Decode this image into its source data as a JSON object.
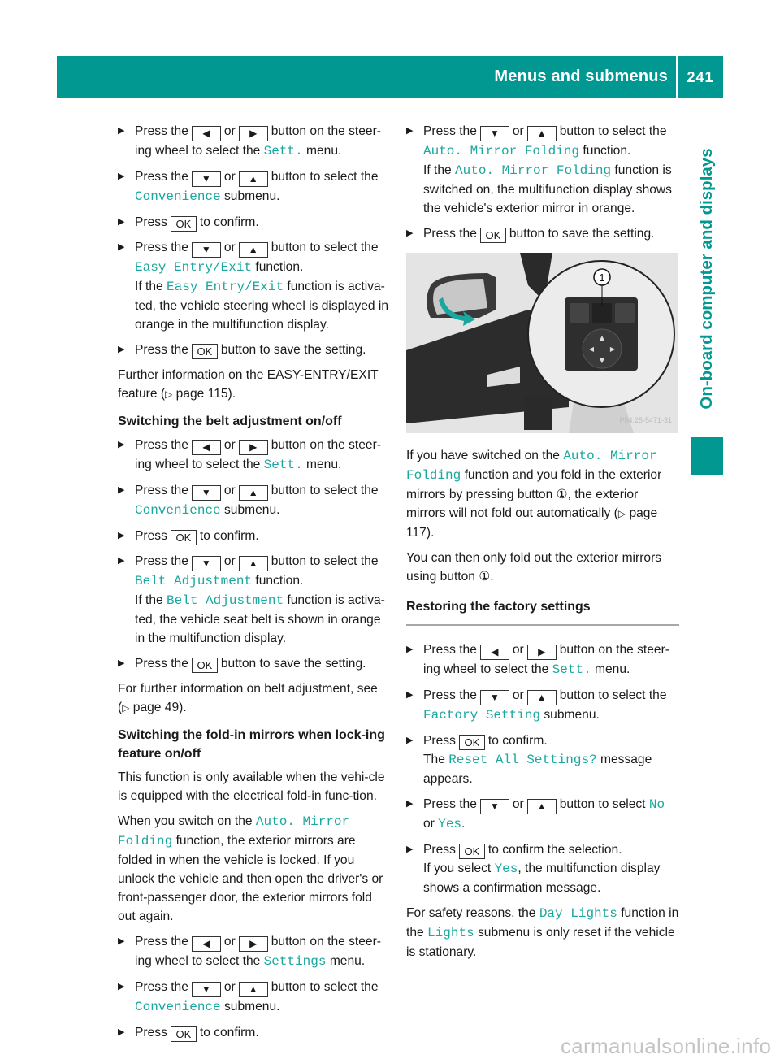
{
  "header": {
    "title": "Menus and submenus",
    "page_number": "241"
  },
  "side_tab": {
    "label": "On-board computer and displays"
  },
  "keys": {
    "left": "◀",
    "right": "▶",
    "down": "▼",
    "up": "▲",
    "ok": "OK"
  },
  "bullet": "▶",
  "ref_arrow": "▷",
  "left_column": {
    "s1": {
      "a": "Press the",
      "or": "or",
      "b": "button on the steer-ing wheel to select the",
      "term": "Sett.",
      "c": "menu."
    },
    "s2": {
      "a": "Press the",
      "or": "or",
      "b": "button to select the",
      "term": "Convenience",
      "c": "submenu."
    },
    "s3": {
      "a": "Press",
      "b": "to confirm."
    },
    "s4": {
      "a": "Press the",
      "or": "or",
      "b": "button to select the",
      "term": "Easy Entry/Exit",
      "c": "function.",
      "d": "If the",
      "term2": "Easy Entry/Exit",
      "e": "function is activa-ted, the vehicle steering wheel is displayed in orange in the multifunction display."
    },
    "s5": {
      "a": "Press the",
      "b": "button to save the setting."
    },
    "p1": {
      "a": "Further information on the EASY-ENTRY/EXIT feature (",
      "ref": "page 115",
      "b": ")."
    },
    "h1": "Switching the belt adjustment on/off",
    "s6": {
      "a": "Press the",
      "or": "or",
      "b": "button on the steer-ing wheel to select the",
      "term": "Sett.",
      "c": "menu."
    },
    "s7": {
      "a": "Press the",
      "or": "or",
      "b": "button to select the",
      "term": "Convenience",
      "c": "submenu."
    },
    "s8": {
      "a": "Press",
      "b": "to confirm."
    },
    "s9": {
      "a": "Press the",
      "or": "or",
      "b": "button to select the",
      "term": "Belt Adjustment",
      "c": "function.",
      "d": "If the",
      "term2": "Belt Adjustment",
      "e": "function is activa-ted, the vehicle seat belt is shown in orange in the multifunction display."
    },
    "s10": {
      "a": "Press the",
      "b": "button to save the setting."
    },
    "p2": {
      "a": "For further information on belt adjustment, see (",
      "ref": "page 49",
      "b": ")."
    },
    "h2": "Switching the fold-in mirrors when lock-ing feature on/off",
    "p3": "This function is only available when the vehi-cle is equipped with the electrical fold-in func-tion.",
    "p4": {
      "a": "When you switch on the",
      "term": "Auto. Mirror Folding",
      "b": "function, the exterior mirrors are folded in when the vehicle is locked. If you unlock the vehicle and then open the driver's or front-passenger door, the exterior mirrors fold out again."
    },
    "s11": {
      "a": "Press the",
      "or": "or",
      "b": "button on the steer-ing wheel to select the",
      "term": "Settings",
      "c": "menu."
    },
    "s12": {
      "a": "Press the",
      "or": "or",
      "b": "button to select the",
      "term": "Convenience",
      "c": "submenu."
    },
    "s13": {
      "a": "Press",
      "b": "to confirm."
    }
  },
  "right_column": {
    "s1": {
      "a": "Press the",
      "or": "or",
      "b": "button to select the",
      "term": "Auto. Mirror Folding",
      "c": "function.",
      "d": "If the",
      "term2": "Auto. Mirror Folding",
      "e": "function is switched on, the multifunction display shows the vehicle's exterior mirror in orange."
    },
    "s2": {
      "a": "Press the",
      "b": "button to save the setting."
    },
    "figure": {
      "callout": "1",
      "code": "P54.25-5471-31"
    },
    "p1": {
      "a": "If you have switched on the",
      "term": "Auto. Mirror Folding",
      "b": "function and you fold in the exterior mirrors by pressing button",
      "callout": "①",
      "c": ", the exterior mirrors will not fold out automatically (",
      "ref": "page 117",
      "d": ")."
    },
    "p2": {
      "a": "You can then only fold out the exterior mirrors using button",
      "callout": "①",
      "b": "."
    },
    "h1": "Restoring the factory settings",
    "s3": {
      "a": "Press the",
      "or": "or",
      "b": "button on the steer-ing wheel to select the",
      "term": "Sett.",
      "c": "menu."
    },
    "s4": {
      "a": "Press the",
      "or": "or",
      "b": "button to select the",
      "term": "Factory Setting",
      "c": "submenu."
    },
    "s5": {
      "a": "Press",
      "b": "to confirm.",
      "d": "The",
      "term": "Reset All Settings?",
      "e": "message appears."
    },
    "s6": {
      "a": "Press the",
      "or": "or",
      "b": "button to select",
      "term": "No",
      "c": "or",
      "term2": "Yes",
      "d": "."
    },
    "s7": {
      "a": "Press",
      "b": "to confirm the selection.",
      "c": "If you select",
      "term": "Yes",
      "d": ", the multifunction display shows a confirmation message."
    },
    "p3": {
      "a": "For safety reasons, the",
      "term": "Day Lights",
      "b": "function in the",
      "term2": "Lights",
      "c": "submenu is only reset if the vehicle is stationary."
    }
  },
  "watermark": "carmanualsonline.info"
}
